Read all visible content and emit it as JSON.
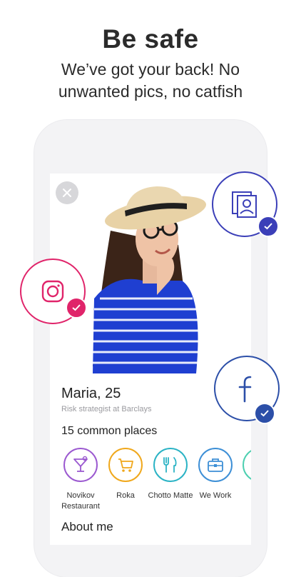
{
  "header": {
    "title": "Be safe",
    "subtitle_line1": "We’ve got your back! No",
    "subtitle_line2": "unwanted pics, no catfish"
  },
  "profile": {
    "name": "Maria, 25",
    "job": "Risk strategist at Barclays"
  },
  "common_places": {
    "heading": "15 common places",
    "items": [
      {
        "label_line1": "Novikov",
        "label_line2": "Restaurant",
        "icon": "cocktail-icon",
        "color": "#9b59d0"
      },
      {
        "label_line1": "Roka",
        "label_line2": "",
        "icon": "shopping-cart-icon",
        "color": "#f0a81c"
      },
      {
        "label_line1": "Chotto Matte",
        "label_line2": "",
        "icon": "fork-knife-icon",
        "color": "#2bb3c5"
      },
      {
        "label_line1": "We Work",
        "label_line2": "",
        "icon": "briefcase-icon",
        "color": "#3d8fd6"
      }
    ]
  },
  "about": {
    "heading": "About me"
  },
  "badges": {
    "photo_color": "#3b3fb8",
    "instagram_color": "#e0246a",
    "facebook_color": "#2c4fa8"
  }
}
